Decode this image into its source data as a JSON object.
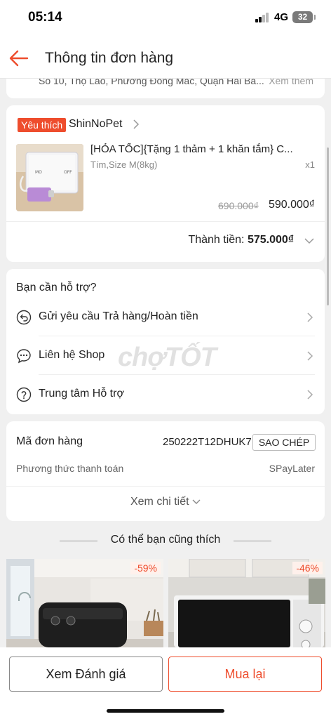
{
  "status_bar": {
    "time": "05:14",
    "network": "4G",
    "battery": "32"
  },
  "header": {
    "title": "Thông tin đơn hàng"
  },
  "address": {
    "text": "Số 10, Thọ Lão, Phường Đống Mác, Quận Hai Bà...",
    "more": "Xem thêm"
  },
  "shop": {
    "badge": "Yêu thích",
    "name": "ShinNoPet",
    "product": {
      "name": "[HỎA TỐC]{Tặng 1 thảm + 1 khăn tắm} C...",
      "variant": "Tím,Size M(8kg)",
      "qty": "x1",
      "old_price": "690.000₫",
      "price": "590.000₫"
    },
    "total_label": "Thành tiền:",
    "total_value": "575.000₫"
  },
  "support": {
    "title": "Bạn cần hỗ trợ?",
    "items": [
      {
        "label": "Gửi yêu cầu Trả hàng/Hoàn tiền",
        "icon": "return-icon"
      },
      {
        "label": "Liên hệ Shop",
        "icon": "chat-icon"
      },
      {
        "label": "Trung tâm Hỗ trợ",
        "icon": "help-icon"
      }
    ]
  },
  "order": {
    "code_label": "Mã đơn hàng",
    "code_value": "250222T12DHUK7",
    "copy_label": "SAO CHÉP",
    "payment_label": "Phương thức thanh toán",
    "payment_value": "SPayLater",
    "more_label": "Xem chi tiết"
  },
  "watermark": "chợTỐT",
  "recommend": {
    "title": "Có thể bạn cũng thích",
    "items": [
      {
        "discount": "-59%"
      },
      {
        "discount": "-46%"
      }
    ]
  },
  "actions": {
    "review_label": "Xem Đánh giá",
    "buy_again_label": "Mua lại"
  },
  "colors": {
    "accent": "#ee4d2d",
    "background": "#f0f0f0"
  }
}
